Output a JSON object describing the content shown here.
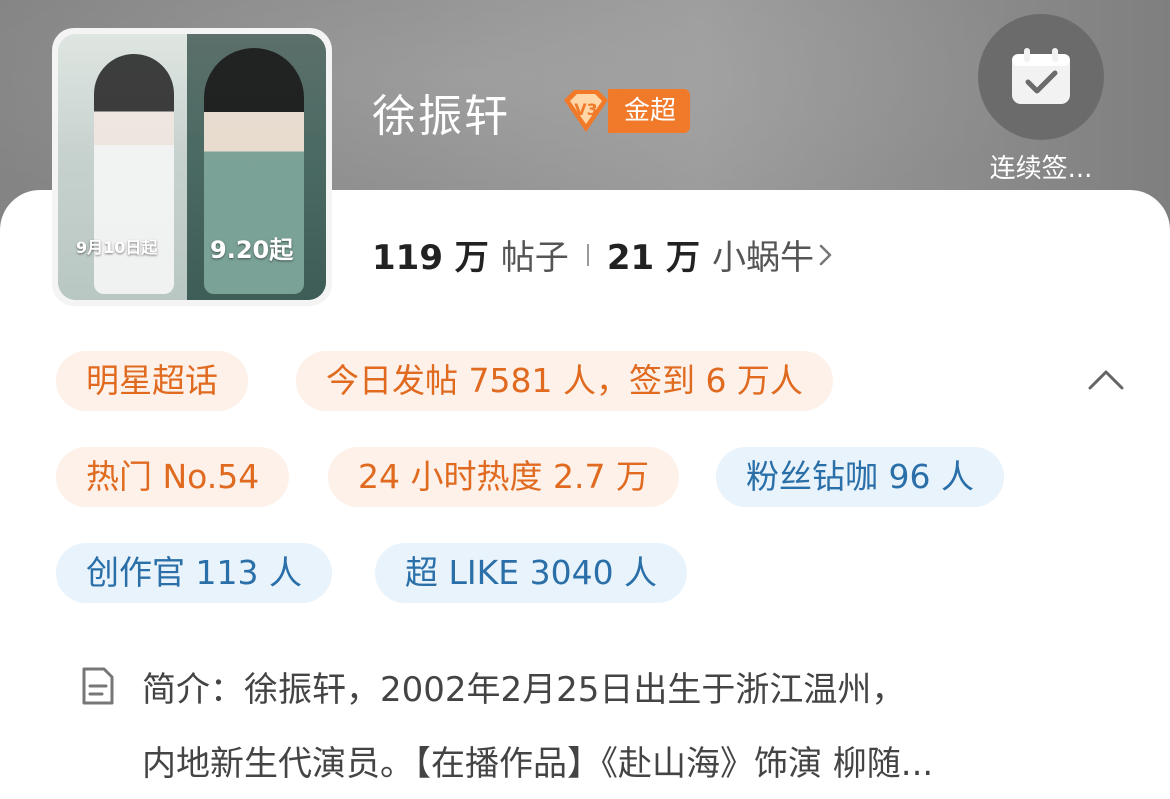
{
  "header": {
    "title": "徐振轩",
    "badge_label": "金超",
    "checkin_label": "连续签...",
    "poster_dates": [
      "9月10日起",
      "9.20起"
    ]
  },
  "stats": {
    "posts_count": "119 万",
    "posts_label": "帖子",
    "followers_count": "21 万",
    "followers_label": "小蜗牛"
  },
  "chips": {
    "star_topic": "明星超话",
    "daily": "今日发帖 7581 人，签到 6 万人",
    "hot_rank": "热门 No.54",
    "heat": "24 小时热度 2.7 万",
    "diamond_fans": "粉丝钻咖 96 人",
    "creators": "创作官 113 人",
    "super_like": "超 LIKE 3040 人"
  },
  "intro": {
    "line1": "简介：徐振轩，2002年2月25日出生于浙江温州，",
    "line2": "内地新生代演员。【在播作品】《赴山海》饰演 柳随..."
  },
  "colors": {
    "orange_text": "#e06a1f",
    "orange_bg": "#fdf1e9",
    "blue_text": "#2a6fa8",
    "blue_bg": "#e8f3fc",
    "badge": "#f07a2a"
  },
  "icons": [
    "calendar-check-icon",
    "chevron-up-icon",
    "document-icon",
    "chevron-right-icon",
    "gem-badge-icon"
  ]
}
